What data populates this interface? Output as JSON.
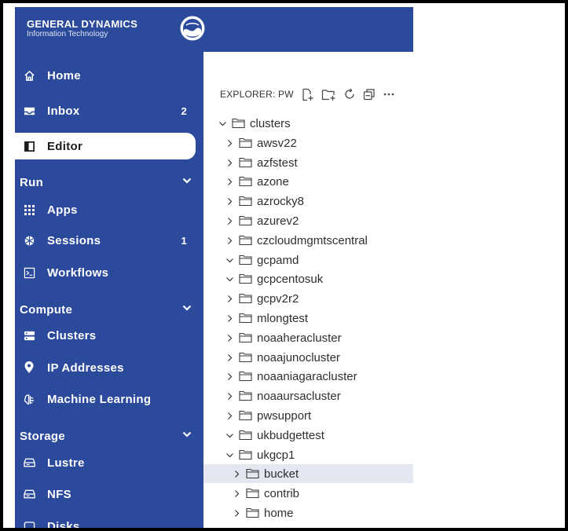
{
  "brand": {
    "name": "GENERAL DYNAMICS",
    "subtitle": "Information Technology",
    "logo": "noaa-logo"
  },
  "colors": {
    "sidebar": "#2b4a9c",
    "selected_row": "#e4e6f1"
  },
  "nav": {
    "home": "Home",
    "inbox": "Inbox",
    "inbox_count": "2",
    "editor": "Editor",
    "run_section": "Run",
    "apps": "Apps",
    "sessions": "Sessions",
    "sessions_count": "1",
    "workflows": "Workflows",
    "compute_section": "Compute",
    "clusters": "Clusters",
    "ip_addresses": "IP Addresses",
    "machine_learning": "Machine Learning",
    "storage_section": "Storage",
    "lustre": "Lustre",
    "nfs": "NFS",
    "disks": "Disks"
  },
  "explorer": {
    "title": "EXPLORER: PW",
    "tree": [
      {
        "label": "clusters",
        "expanded": true,
        "depth": 0
      },
      {
        "label": "awsv22",
        "expanded": false,
        "depth": 1
      },
      {
        "label": "azfstest",
        "expanded": false,
        "depth": 1
      },
      {
        "label": "azone",
        "expanded": false,
        "depth": 1
      },
      {
        "label": "azrocky8",
        "expanded": false,
        "depth": 1
      },
      {
        "label": "azurev2",
        "expanded": false,
        "depth": 1
      },
      {
        "label": "czcloudmgmtscentral",
        "expanded": false,
        "depth": 1
      },
      {
        "label": "gcpamd",
        "expanded": true,
        "depth": 1
      },
      {
        "label": "gcpcentosuk",
        "expanded": true,
        "depth": 1
      },
      {
        "label": "gcpv2r2",
        "expanded": false,
        "depth": 1
      },
      {
        "label": "mlongtest",
        "expanded": false,
        "depth": 1
      },
      {
        "label": "noaaheracluster",
        "expanded": false,
        "depth": 1
      },
      {
        "label": "noaajunocluster",
        "expanded": false,
        "depth": 1
      },
      {
        "label": "noaaniagaracluster",
        "expanded": false,
        "depth": 1
      },
      {
        "label": "noaaursacluster",
        "expanded": false,
        "depth": 1
      },
      {
        "label": "pwsupport",
        "expanded": false,
        "depth": 1
      },
      {
        "label": "ukbudgettest",
        "expanded": true,
        "depth": 1
      },
      {
        "label": "ukgcp1",
        "expanded": true,
        "depth": 1
      },
      {
        "label": "bucket",
        "expanded": false,
        "depth": 2,
        "selected": true
      },
      {
        "label": "contrib",
        "expanded": false,
        "depth": 2
      },
      {
        "label": "home",
        "expanded": false,
        "depth": 2
      }
    ]
  }
}
